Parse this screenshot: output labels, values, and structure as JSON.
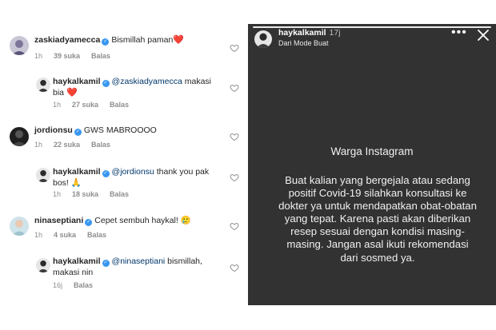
{
  "comments": [
    {
      "username": "zaskiadyamecca",
      "text": "Bismillah paman",
      "emoji": "❤️",
      "time": "1h",
      "likes": "39 suka",
      "reply": "Balas"
    },
    {
      "username": "haykalkamil",
      "mention": "@zaskiadyamecca",
      "text": " makasi bia ",
      "emoji": "❤️",
      "time": "1h",
      "likes": "27 suka",
      "reply": "Balas"
    },
    {
      "username": "jordionsu",
      "text": "GWS MABROOOO",
      "time": "1h",
      "likes": "22 suka",
      "reply": "Balas"
    },
    {
      "username": "haykalkamil",
      "mention": "@jordionsu",
      "text": " thank you pak bos! ",
      "emoji": "🙏",
      "time": "1h",
      "likes": "18 suka",
      "reply": "Balas"
    },
    {
      "username": "ninaseptiani",
      "text": "Cepet sembuh haykal! ",
      "emoji": "🥲",
      "time": "1h",
      "likes": "4 suka",
      "reply": "Balas"
    },
    {
      "username": "haykalkamil",
      "mention": "@ninaseptiani",
      "text": " bismillah, makasi nin",
      "time": "16j",
      "reply": "Balas"
    }
  ],
  "story": {
    "username": "haykalkamil",
    "time": "17j",
    "subtitle": "Dari Mode Buat",
    "more_label": "•••",
    "title": "Warga Instagram",
    "body": "Buat kalian yang bergejala atau sedang positif Covid-19 silahkan konsultasi ke dokter ya untuk mendapatkan obat-obatan yang tepat. Karena pasti akan diberikan resep sesuai dengan kondisi masing-masing. Jangan asal ikuti rekomendasi dari sosmed ya."
  },
  "colors": {
    "verified": "#3897f0",
    "mention": "#00376b",
    "meta": "#8e8e8e",
    "story_bg": "#323232"
  },
  "icons": [
    "verified-badge-icon",
    "heart-outline-icon",
    "close-icon",
    "more-icon"
  ]
}
